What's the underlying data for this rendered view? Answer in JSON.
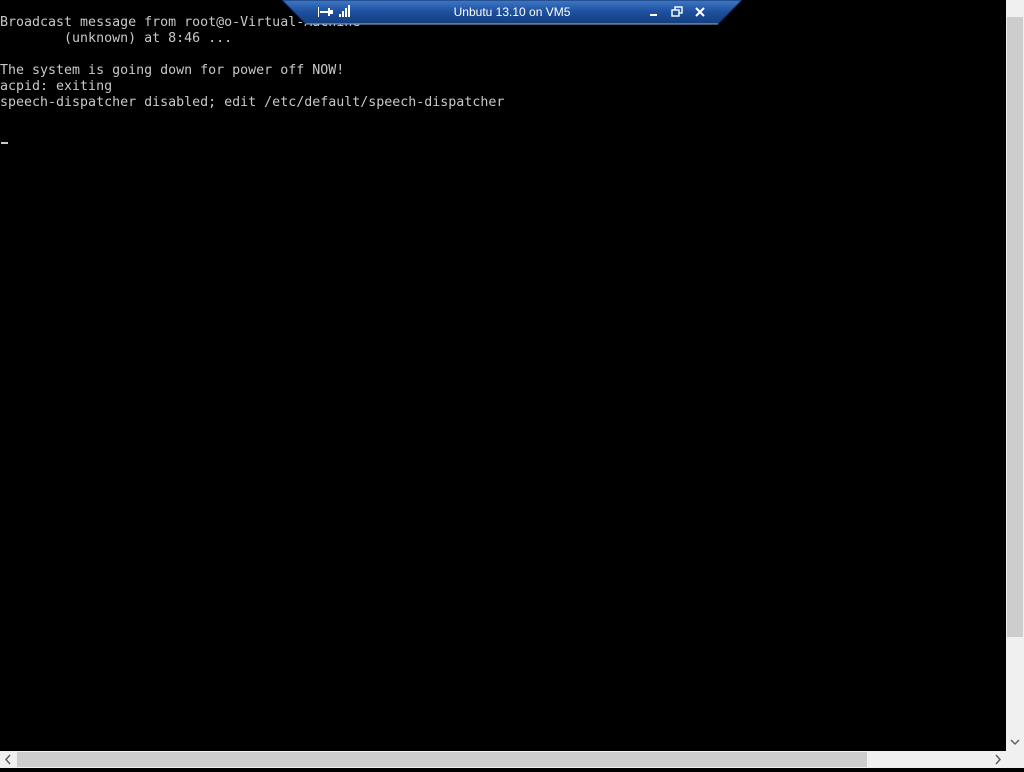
{
  "connection_bar": {
    "title": "Unbutu 13.10 on VM5",
    "pin_icon": "pin-icon",
    "signal_icon": "signal-strength-icon",
    "minimize_icon": "minimize-icon",
    "restore_icon": "restore-icon",
    "close_icon": "close-icon",
    "accent_color": "#1c4f9c"
  },
  "console": {
    "background_color": "#000000",
    "text_color": "#c8c8c8",
    "lines": [
      "Broadcast message from root@o-Virtual-Machine",
      "        (unknown) at 8:46 ...",
      "",
      "The system is going down for power off NOW!",
      "acpid: exiting",
      "speech-dispatcher disabled; edit /etc/default/speech-dispatcher"
    ],
    "cursor": "_"
  }
}
